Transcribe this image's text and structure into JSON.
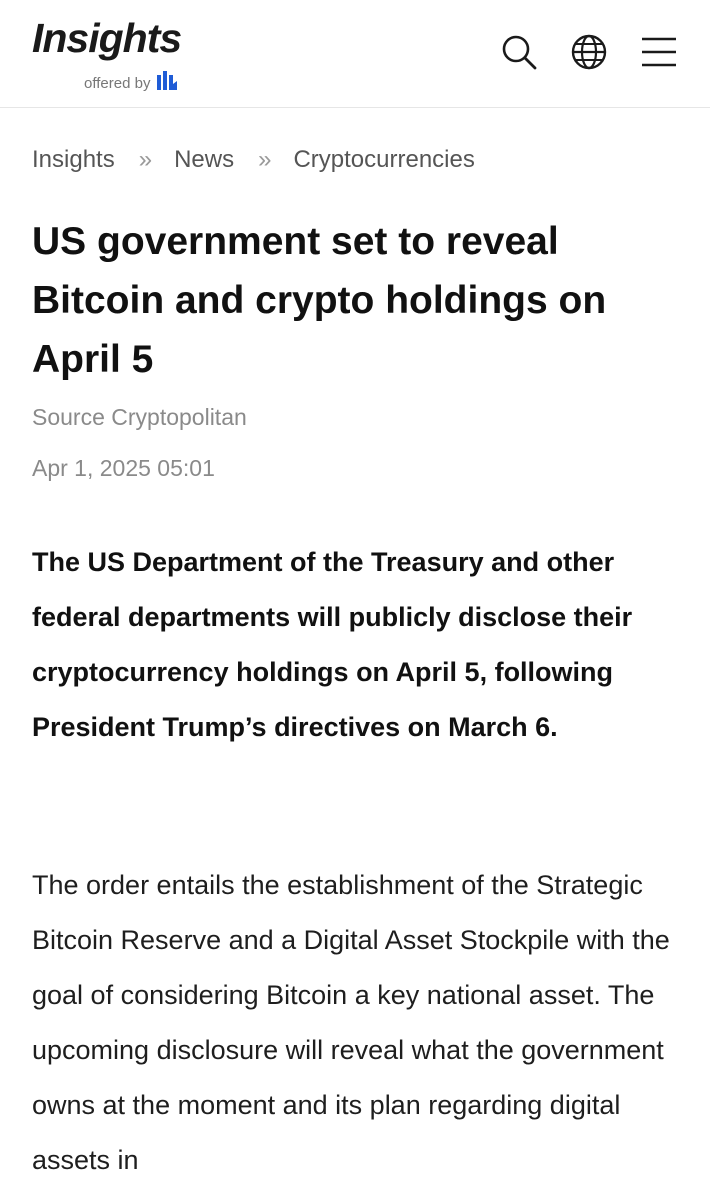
{
  "header": {
    "logo_title": "Insights",
    "logo_offered_by": "offered by",
    "icons": [
      "search-icon",
      "globe-icon",
      "menu-icon"
    ],
    "brand_color": "#1f5cd6"
  },
  "breadcrumb": [
    "Insights",
    "News",
    "Cryptocurrencies"
  ],
  "article": {
    "title": "US government set to reveal Bitcoin and crypto holdings on April 5",
    "source": "Source Cryptopolitan",
    "date": "Apr 1, 2025 05:01",
    "lead": "The US Department of the Treasury and other federal departments will publicly disclose their cryptocurrency holdings on April 5, following President Trump’s directives on March 6.",
    "body": "The order entails the establishment of the Strategic Bitcoin Reserve and a Digital Asset Stockpile with the goal of considering Bitcoin a key national asset. The upcoming disclosure will reveal what the government owns at the moment and its plan regarding digital assets in"
  }
}
